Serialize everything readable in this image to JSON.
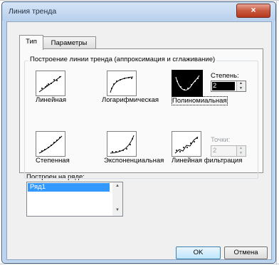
{
  "window": {
    "title": "Линия тренда",
    "close_icon": "×"
  },
  "tabs": [
    {
      "label": "Тип",
      "active": true
    },
    {
      "label": "Параметры",
      "active": false
    }
  ],
  "trend_group": {
    "label": "Построение линии тренда (аппроксимация и сглаживание)",
    "types": [
      {
        "id": "linear",
        "label": "Линейная",
        "icon": "linear-trend-icon",
        "selected": false
      },
      {
        "id": "log",
        "label": "Логарифмическая",
        "icon": "logarithmic-trend-icon",
        "selected": false
      },
      {
        "id": "poly",
        "label": "Полиномиальная",
        "icon": "polynomial-trend-icon",
        "selected": true
      },
      {
        "id": "power",
        "label": "Степенная",
        "icon": "power-trend-icon",
        "selected": false
      },
      {
        "id": "exp",
        "label": "Экспоненциальная",
        "icon": "exponential-trend-icon",
        "selected": false
      },
      {
        "id": "movavg",
        "label": "Линейная фильтрация",
        "icon": "moving-average-trend-icon",
        "selected": false
      }
    ],
    "degree": {
      "label": "Степень:",
      "value": "2"
    },
    "period": {
      "label": "Точки:",
      "value": "2"
    }
  },
  "series": {
    "label": "Построен на ряде:",
    "items": [
      "Ряд1"
    ]
  },
  "buttons": {
    "ok": "OK",
    "cancel": "Отмена"
  },
  "colors": {
    "window_frame": "#bcd3ee",
    "close_button": "#c75a40",
    "selection": "#3399ff"
  }
}
